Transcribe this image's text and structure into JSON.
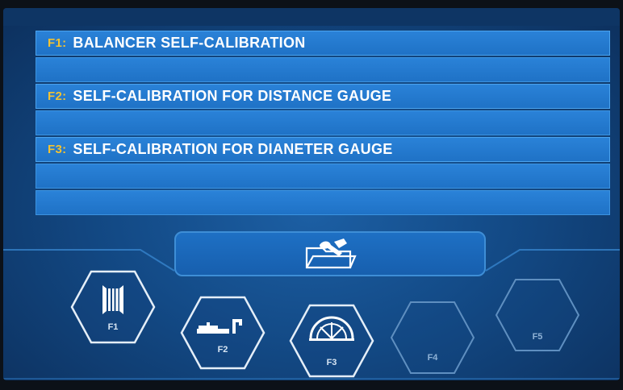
{
  "menu": {
    "items": [
      {
        "key": "F1:",
        "label": "BALANCER SELF-CALIBRATION"
      },
      {
        "key": "F2:",
        "label": "SELF-CALIBRATION FOR DISTANCE GAUGE"
      },
      {
        "key": "F3:",
        "label": "SELF-CALIBRATION FOR DIANETER GAUGE"
      }
    ]
  },
  "folder_button": {
    "icon": "folder-wrench-icon"
  },
  "function_keys": [
    {
      "label": "F1",
      "icon": "wheel-rim-icon",
      "enabled": true
    },
    {
      "label": "F2",
      "icon": "distance-gauge-icon",
      "enabled": true
    },
    {
      "label": "F3",
      "icon": "diameter-gauge-icon",
      "enabled": true
    },
    {
      "label": "F4",
      "icon": "",
      "enabled": false
    },
    {
      "label": "F5",
      "icon": "",
      "enabled": false
    }
  ],
  "colors": {
    "screen_bg": "#134a86",
    "row_bg": "#2274c8",
    "fkey_text": "#f2c232",
    "hex_outline": "#e4eef8",
    "hex_outline_disabled": "#5f8fc0"
  }
}
